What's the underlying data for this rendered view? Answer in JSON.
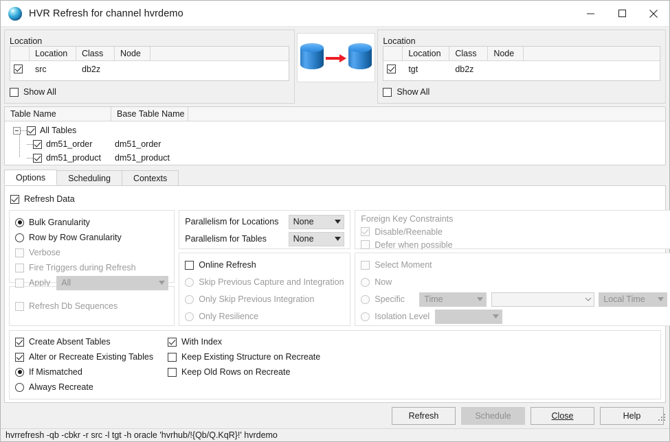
{
  "window": {
    "title": "HVR Refresh for channel hvrdemo",
    "icon": "hvr-sphere-icon",
    "controls": {
      "minimize": "minimize",
      "maximize": "maximize",
      "close": "close"
    }
  },
  "source_location": {
    "group_title": "Location",
    "columns": [
      "",
      "Location",
      "Class",
      "Node"
    ],
    "rows": [
      {
        "checked": true,
        "location": "src",
        "class": "db2z",
        "node": ""
      }
    ],
    "show_all_label": "Show All",
    "show_all_checked": false
  },
  "target_location": {
    "group_title": "Location",
    "columns": [
      "",
      "Location",
      "Class",
      "Node"
    ],
    "rows": [
      {
        "checked": true,
        "location": "tgt",
        "class": "db2z",
        "node": ""
      }
    ],
    "show_all_label": "Show All",
    "show_all_checked": false
  },
  "transfer_icon": {
    "name": "database-to-database-arrow",
    "arrow_color": "#ed1c24",
    "db_color": "#3f9aea"
  },
  "tables": {
    "columns": [
      "Table Name",
      "Base Table Name"
    ],
    "root": {
      "label": "All Tables",
      "checked": true
    },
    "rows": [
      {
        "table_name": "dm51_order",
        "base_table_name": "dm51_order",
        "checked": true
      },
      {
        "table_name": "dm51_product",
        "base_table_name": "dm51_product",
        "checked": true
      }
    ]
  },
  "tabs": [
    {
      "label": "Options",
      "active": true
    },
    {
      "label": "Scheduling",
      "active": false
    },
    {
      "label": "Contexts",
      "active": false
    }
  ],
  "options": {
    "refresh_data": {
      "label": "Refresh Data",
      "checked": true,
      "enabled": true
    },
    "granularity": [
      {
        "label": "Bulk Granularity",
        "selected": true,
        "enabled": true
      },
      {
        "label": "Row by Row Granularity",
        "selected": false,
        "enabled": true
      }
    ],
    "verbose": {
      "label": "Verbose",
      "checked": false,
      "enabled": false
    },
    "fire_triggers": {
      "label": "Fire Triggers during Refresh",
      "checked": false,
      "enabled": false
    },
    "apply": {
      "label": "Apply",
      "checked": false,
      "enabled": false,
      "value": "All"
    },
    "refresh_db_sequences": {
      "label": "Refresh Db Sequences",
      "checked": false,
      "enabled": false
    },
    "parallelism_for_locations": {
      "label": "Parallelism for Locations",
      "value": "None",
      "enabled": true
    },
    "parallelism_for_tables": {
      "label": "Parallelism for Tables",
      "value": "None",
      "enabled": true
    },
    "online_refresh": {
      "label": "Online Refresh",
      "checked": false,
      "enabled": true
    },
    "online_modes": [
      {
        "label": "Skip Previous Capture and Integration",
        "selected": false,
        "enabled": false
      },
      {
        "label": "Only Skip Previous Integration",
        "selected": false,
        "enabled": false
      },
      {
        "label": "Only Resilience",
        "selected": false,
        "enabled": false
      }
    ],
    "foreign_key_constraints": {
      "title": "Foreign Key Constraints",
      "disable_reenable": {
        "label": "Disable/Reenable",
        "checked": true,
        "enabled": false
      },
      "defer_when_possible": {
        "label": "Defer when possible",
        "checked": false,
        "enabled": false
      }
    },
    "select_moment": {
      "label": "Select Moment",
      "checked": false,
      "enabled": false,
      "now": {
        "label": "Now",
        "selected": false,
        "enabled": false
      },
      "specific": {
        "label": "Specific",
        "selected": false,
        "enabled": false,
        "type_value": "Time",
        "moment_value": "",
        "timezone_value": "Local Time"
      },
      "isolation_level": {
        "label": "Isolation Level",
        "selected": false,
        "enabled": false,
        "value": ""
      }
    }
  },
  "table_options": {
    "create_absent_tables": {
      "label": "Create Absent Tables",
      "checked": true
    },
    "alter_or_recreate": {
      "label": "Alter or Recreate Existing Tables",
      "checked": true
    },
    "if_mismatched": {
      "label": "If Mismatched",
      "selected": true
    },
    "always_recreate": {
      "label": "Always Recreate",
      "selected": false
    },
    "with_index": {
      "label": "With Index",
      "checked": true
    },
    "keep_existing_structure": {
      "label": "Keep Existing Structure on Recreate",
      "checked": false
    },
    "keep_old_rows": {
      "label": "Keep Old Rows on Recreate",
      "checked": false
    }
  },
  "buttons": {
    "refresh": {
      "label": "Refresh",
      "enabled": true
    },
    "schedule": {
      "label": "Schedule",
      "enabled": false
    },
    "close": {
      "label": "Close",
      "accel": "C",
      "enabled": true
    },
    "help": {
      "label": "Help",
      "enabled": true
    }
  },
  "statusbar": {
    "command": "hvrrefresh -qb -cbkr -r src -l tgt -h oracle 'hvrhub/!{Qb/Q.KqR}!' hvrdemo"
  }
}
